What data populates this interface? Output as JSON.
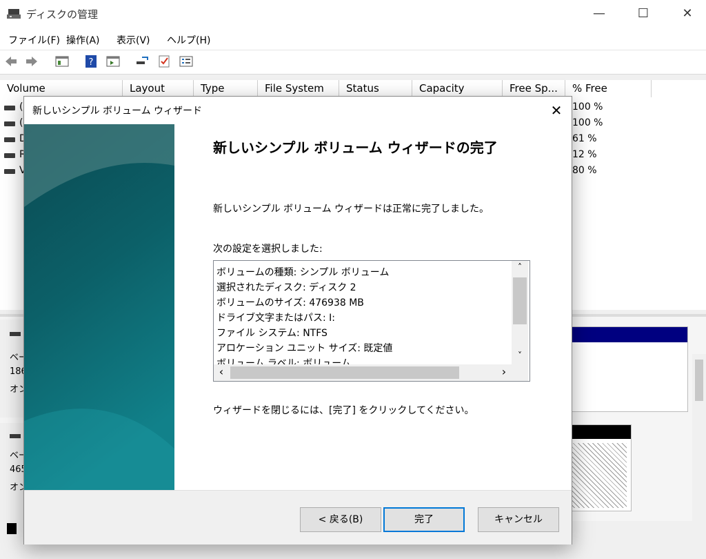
{
  "app": {
    "title": "ディスクの管理"
  },
  "menu": [
    "ファイル(F)",
    "操作(A)",
    "表示(V)",
    "ヘルプ(H)"
  ],
  "columns": [
    "Volume",
    "Layout",
    "Type",
    "File System",
    "Status",
    "Capacity",
    "Free Sp...",
    "% Free"
  ],
  "volumes": [
    {
      "name": "(",
      "free_pct": "100 %"
    },
    {
      "name": "(",
      "free_pct": "100 %"
    },
    {
      "name": "D",
      "free_pct": "61 %"
    },
    {
      "name": "R",
      "free_pct": "12 %"
    },
    {
      "name": "V",
      "free_pct": "80 %"
    }
  ],
  "disks": [
    {
      "line1": "ベー",
      "line2": "186",
      "line3": "オン"
    },
    {
      "line1": "ベー",
      "line2": "465",
      "line3": "オン"
    }
  ],
  "dialog": {
    "title": "新しいシンプル ボリューム ウィザード",
    "close_glyph": "✕",
    "heading": "新しいシンプル ボリューム ウィザードの完了",
    "message": "新しいシンプル ボリューム ウィザードは正常に完了しました。",
    "settings_label": "次の設定を選択しました:",
    "settings": [
      "ボリュームの種類: シンプル ボリューム",
      "選択されたディスク: ディスク 2",
      "ボリュームのサイズ: 476938 MB",
      "ドライブ文字またはパス: I:",
      "ファイル システム: NTFS",
      "アロケーション ユニット サイズ: 既定値",
      "ボリューム ラベル: ボリューム"
    ],
    "close_instruction": "ウィザードを閉じるには、[完了] をクリックしてください。",
    "buttons": {
      "back": "< 戻る(B)",
      "finish": "完了",
      "cancel": "キャンセル"
    }
  },
  "window_controls": {
    "minimize": "—",
    "maximize": "☐",
    "close": "✕"
  },
  "scroll_glyphs": {
    "up": "˄",
    "down": "˅",
    "left": "‹",
    "right": "›"
  },
  "colors": {
    "accent": "#0078d7",
    "navy": "#000080"
  }
}
